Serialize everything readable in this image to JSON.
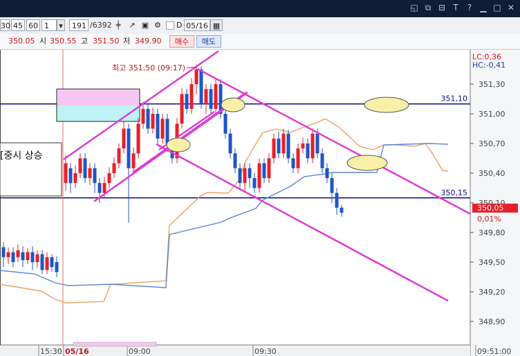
{
  "title_icons": [
    "restore-icon",
    "tile-icon",
    "pin-icon",
    "font-icon",
    "help-icon",
    "minimize-icon",
    "maximize-icon",
    "close-icon"
  ],
  "toolbar": {
    "intervals": [
      "30",
      "45",
      "60"
    ],
    "period": "1",
    "count": "191",
    "count_total": "/6392",
    "check_label": "D",
    "date": "05/16"
  },
  "quote": {
    "price": "350.05",
    "open_label": "시",
    "open": "350.55",
    "high_label": "고",
    "high": "351.50",
    "low_label": "저",
    "low": "349.90",
    "buy": "매수",
    "sell": "매도"
  },
  "chart_data": {
    "type": "candlestick",
    "y_ticks": [
      "351,30",
      "351,00",
      "350,70",
      "350,40",
      "350,10",
      "349,80",
      "349,50",
      "349,20",
      "348,90"
    ],
    "x_ticks": [
      "15:30",
      "05/16",
      "09:00",
      "09:30",
      "09:51:00"
    ],
    "indicators": {
      "lc": "LC:0,36",
      "hc": "HC:-0,41"
    },
    "high_annotation": "최고 351,50 (09:17)",
    "left_note": "[중시 상승",
    "hlines": [
      {
        "value": 351.1,
        "label": "351,10"
      },
      {
        "value": 350.15,
        "label": "350,15"
      }
    ],
    "current": {
      "value": 350.05,
      "label": "350,05",
      "change": "0,01%"
    },
    "colors": {
      "up": "#e8202a",
      "down": "#1f55c8",
      "channel": "#e23ad6",
      "hline": "#0a0a8c",
      "orange_line": "#f0a060",
      "blue_line": "#5a86d8"
    }
  }
}
